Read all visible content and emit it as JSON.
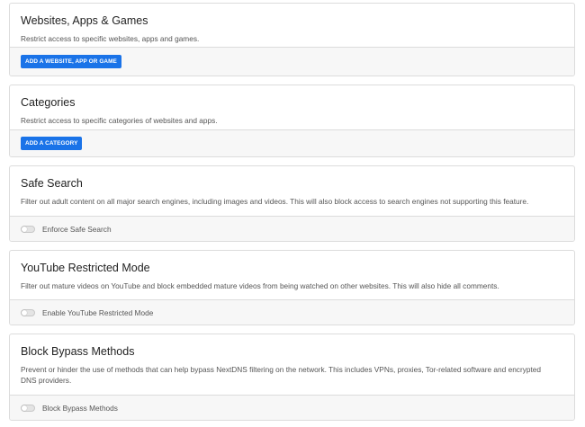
{
  "sections": [
    {
      "title": "Websites, Apps & Games",
      "description": "Restrict access to specific websites, apps and games.",
      "button_label": "ADD A WEBSITE, APP OR GAME"
    },
    {
      "title": "Categories",
      "description": "Restrict access to specific categories of websites and apps.",
      "button_label": "ADD A CATEGORY"
    },
    {
      "title": "Safe Search",
      "description": "Filter out adult content on all major search engines, including images and videos. This will also block access to search engines not supporting this feature.",
      "toggle_label": "Enforce Safe Search",
      "toggle_on": false
    },
    {
      "title": "YouTube Restricted Mode",
      "description": "Filter out mature videos on YouTube and block embedded mature videos from being watched on other websites. This will also hide all comments.",
      "toggle_label": "Enable YouTube Restricted Mode",
      "toggle_on": false
    },
    {
      "title": "Block Bypass Methods",
      "description": "Prevent or hinder the use of methods that can help bypass NextDNS filtering on the network. This includes VPNs, proxies, Tor-related software and encrypted DNS providers.",
      "toggle_label": "Block Bypass Methods",
      "toggle_on": false
    }
  ],
  "colors": {
    "accent": "#1a73e8",
    "footer_bg": "#f7f7f7",
    "border": "#dcdcdc"
  }
}
